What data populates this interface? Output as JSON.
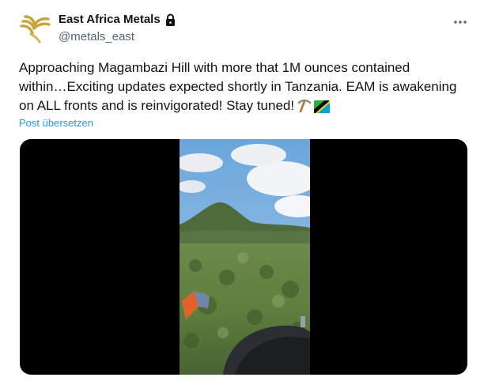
{
  "author": {
    "display_name": "East Africa Metals",
    "handle": "@metals_east",
    "avatar_icon": "east-africa-metals-logo-icon",
    "protected_icon": "lock-icon"
  },
  "more_icon": "more-options-icon",
  "tweet": {
    "text": "Approaching Magambazi Hill with more that 1M ounces contained\nwithin…Exciting updates expected shortly in Tanzania. EAM is awakening\non ALL fronts and is reinvigorated! Stay tuned!",
    "emojis": [
      "pick-icon",
      "tanzania-flag-icon"
    ]
  },
  "translate_label": "Post übersetzen",
  "media": {
    "type": "video",
    "description_icon": "video-player"
  },
  "colors": {
    "text": "#0f1419",
    "secondary": "#536471",
    "link": "#1d9bf0",
    "media_bg": "#000000",
    "logo_gold": "#c9a23a"
  }
}
